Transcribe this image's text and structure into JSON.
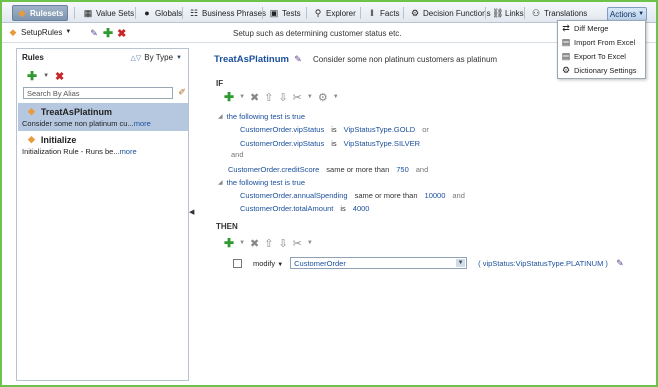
{
  "tabs": [
    {
      "label": "Rulesets",
      "icon": "rulesets-icon",
      "glyph": "◆",
      "active": true
    },
    {
      "label": "Value Sets",
      "icon": "value-sets-icon",
      "glyph": "▦"
    },
    {
      "label": "Globals",
      "icon": "globals-icon",
      "glyph": "●"
    },
    {
      "label": "Business Phrases",
      "icon": "business-phrases-icon",
      "glyph": "☷"
    },
    {
      "label": "Tests",
      "icon": "tests-icon",
      "glyph": "▣"
    },
    {
      "label": "Explorer",
      "icon": "explorer-icon",
      "glyph": "⚲"
    },
    {
      "label": "Facts",
      "icon": "facts-icon",
      "glyph": "‖"
    },
    {
      "label": "Decision Functions",
      "icon": "decision-functions-icon",
      "glyph": "⚙"
    },
    {
      "label": "Links",
      "icon": "links-icon",
      "glyph": "⛓"
    },
    {
      "label": "Translations",
      "icon": "translations-icon",
      "glyph": "⚇"
    }
  ],
  "actions": {
    "label": "Actions",
    "menu": [
      "Diff Merge",
      "Import From Excel",
      "Export To Excel",
      "Dictionary Settings"
    ]
  },
  "ruleset": {
    "name": "SetupRules",
    "description": "Setup such as determining customer status etc."
  },
  "rules_panel": {
    "title": "Rules",
    "sort": "By Type",
    "search_placeholder": "Search By Alias"
  },
  "rules": [
    {
      "name": "TreatAsPlatinum",
      "desc": "Consider some non platinum cu...",
      "more": "more",
      "selected": true
    },
    {
      "name": "Initialize",
      "desc": "Initialization Rule - Runs be...",
      "more": "more",
      "selected": false
    }
  ],
  "editor": {
    "rule_name": "TreatAsPlatinum",
    "rule_desc": "Consider some non platinum customers as platinum",
    "if_label": "IF",
    "then_label": "THEN",
    "test1_label": "the following test is true",
    "test2_label": "the following test is true",
    "cond1": {
      "left": "CustomerOrder.vipStatus",
      "op": "is",
      "right": "VipStatusType.GOLD",
      "conj": "or"
    },
    "cond2": {
      "left": "CustomerOrder.vipStatus",
      "op": "is",
      "right": "VipStatusType.SILVER"
    },
    "and1": "and",
    "cond3": {
      "left": "CustomerOrder.creditScore",
      "op": "same or more than",
      "right": "750",
      "conj": "and"
    },
    "cond4": {
      "left": "CustomerOrder.annualSpending",
      "op": "same or more than",
      "right": "10000",
      "conj": "and"
    },
    "cond5": {
      "left": "CustomerOrder.totalAmount",
      "op": "is",
      "right": "4000"
    },
    "action": {
      "verb": "modify",
      "target": "CustomerOrder",
      "args": "( vipStatus:VipStatusType.PLATINUM )"
    }
  }
}
